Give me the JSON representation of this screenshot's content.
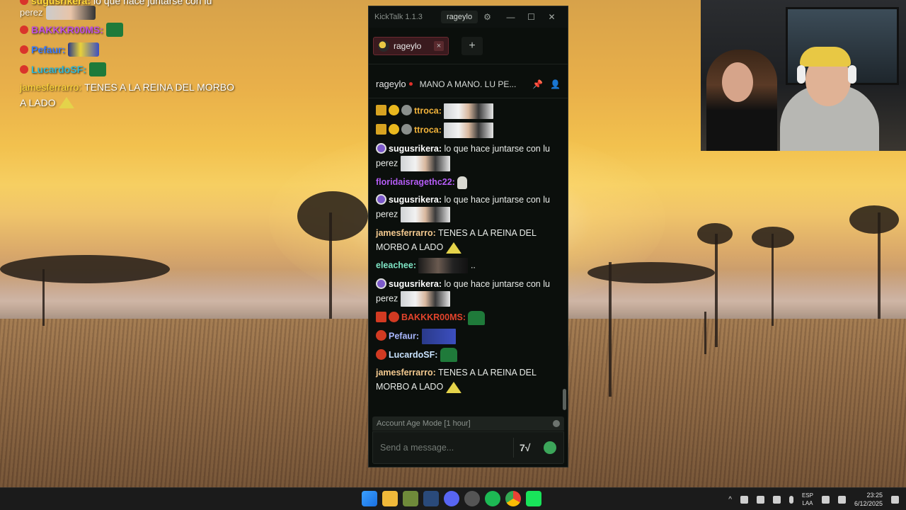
{
  "overlay": {
    "line0_name": "sugusrikera:",
    "line0_text": "lo que hace juntarse con lu",
    "line0b_text": "perez",
    "line1_name": "BAKKKR00MS:",
    "line2_name": "Pefaur:",
    "line3_name": "LucardoSF:",
    "line4_name": "jamesferrarro:",
    "line4_text": "TENES A LA REINA DEL MORBO",
    "line4b_text": "A LADO"
  },
  "window": {
    "app_title": "KickTalk 1.1.3",
    "user": "rageylo",
    "controls": [
      "—",
      "☐",
      "✕"
    ]
  },
  "tabs": [
    {
      "label": "rageylo",
      "close": "×"
    }
  ],
  "add_tab": "+",
  "channel_header": {
    "channel": "rageylo",
    "stream_title": "MANO A MANO. LU PE..."
  },
  "messages": [
    {
      "user": "ttroca:",
      "text": ""
    },
    {
      "user": "ttroca:",
      "text": ""
    },
    {
      "user": "sugusrikera:",
      "text": "lo que hace juntarse con lu perez"
    },
    {
      "user": "floridaisragethc22:",
      "text": ""
    },
    {
      "user": "sugusrikera:",
      "text": "lo que hace juntarse con lu perez"
    },
    {
      "user": "jamesferrarro:",
      "text": "TENES A LA REINA DEL MORBO A LADO"
    },
    {
      "user": "eleachee:",
      "text": ".."
    },
    {
      "user": "sugusrikera:",
      "text": "lo que hace juntarse con lu perez"
    },
    {
      "user": "BAKKKR00MS:",
      "text": ""
    },
    {
      "user": "Pefaur:",
      "text": ""
    },
    {
      "user": "LucardoSF:",
      "text": ""
    },
    {
      "user": "jamesferrarro:",
      "text": "TENES A LA REINA DEL MORBO A LADO"
    }
  ],
  "mode_label": "Account Age Mode [1 hour]",
  "input": {
    "placeholder": "Send a message..."
  },
  "taskbar": {
    "lang_top": "ESP",
    "lang_bottom": "LAA",
    "time": "23:25",
    "date": "6/12/2025"
  }
}
